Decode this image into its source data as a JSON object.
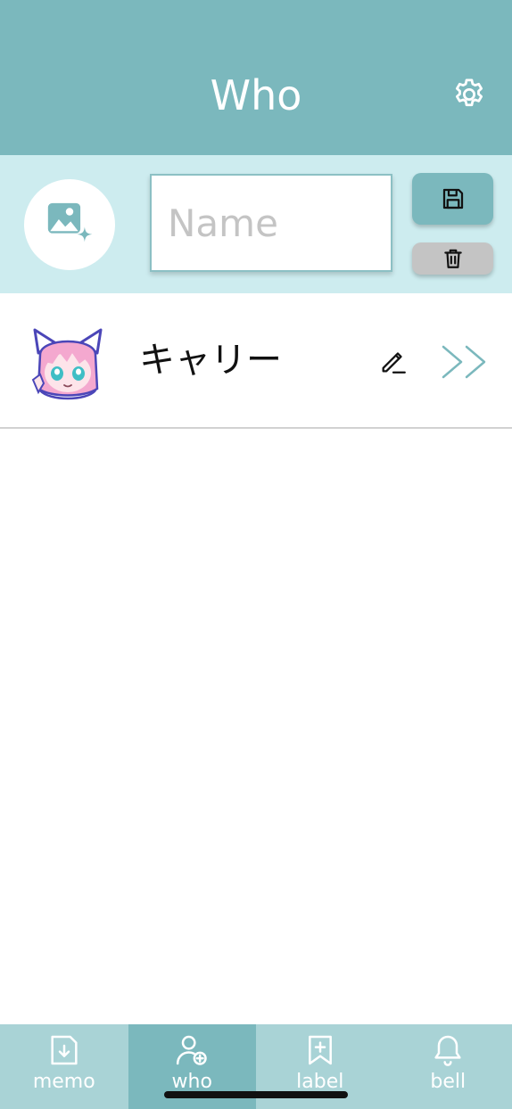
{
  "header": {
    "title": "Who",
    "settings_icon": "gear-icon"
  },
  "form": {
    "avatar_icon": "add-image-icon",
    "name_placeholder": "Name",
    "name_value": "",
    "save_icon": "floppy-disk-icon",
    "delete_icon": "trash-icon"
  },
  "people": [
    {
      "name": "キャリー",
      "avatar": "anime-cat-girl-avatar",
      "edit_icon": "pencil-icon",
      "open_icon": "double-chevron-right-icon"
    }
  ],
  "tabs": [
    {
      "label": "memo",
      "icon": "memo-download-icon",
      "active": false
    },
    {
      "label": "who",
      "icon": "user-add-icon",
      "active": true
    },
    {
      "label": "label",
      "icon": "bookmark-add-icon",
      "active": false
    },
    {
      "label": "bell",
      "icon": "bell-icon",
      "active": false
    }
  ],
  "colors": {
    "accent": "#7bb8bd",
    "panel": "#cdecef",
    "tabbar": "#a9d3d6",
    "delete": "#c4c4c4"
  }
}
